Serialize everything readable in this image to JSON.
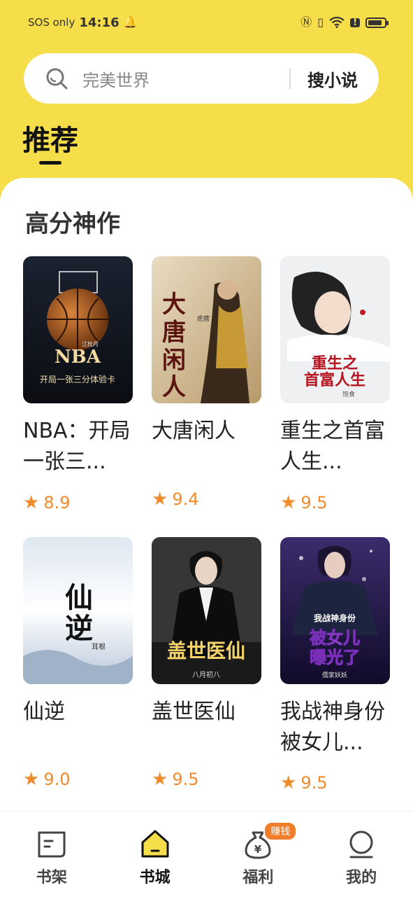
{
  "status_bar": {
    "carrier": "SOS only",
    "time": "14:16",
    "battery_level": 0.85
  },
  "search": {
    "placeholder": "完美世界",
    "button_label": "搜小说"
  },
  "tabs": [
    {
      "label": "推荐",
      "active": true
    }
  ],
  "section": {
    "title": "高分神作"
  },
  "books": [
    {
      "title": "NBA：开局一张三...",
      "rating": "8.9",
      "cover_text": "NBA",
      "cover_sub": "开局一张三分体验卡",
      "cover_author": "江枕月"
    },
    {
      "title": "大唐闲人",
      "rating": "9.4",
      "cover_text": "大唐闲人",
      "cover_author": "疙瘩"
    },
    {
      "title": "重生之首富人生...",
      "rating": "9.5",
      "cover_text": "重生之首富人生",
      "cover_author": "饱食"
    },
    {
      "title": "仙逆",
      "rating": "9.0",
      "cover_text": "仙逆",
      "cover_author": "耳根"
    },
    {
      "title": "盖世医仙",
      "rating": "9.5",
      "cover_text": "盖世医仙",
      "cover_author": "八月初八"
    },
    {
      "title": "我战神身份被女儿...",
      "rating": "9.5",
      "cover_text": "被女儿曝光了",
      "cover_sub": "我战神身份",
      "cover_author": "儒家妖妖"
    }
  ],
  "bottom_nav": [
    {
      "label": "书架",
      "icon": "bookshelf-icon",
      "active": false
    },
    {
      "label": "书城",
      "icon": "bookstore-home-icon",
      "active": true
    },
    {
      "label": "福利",
      "icon": "money-bag-icon",
      "active": false,
      "badge": "赚钱"
    },
    {
      "label": "我的",
      "icon": "profile-icon",
      "active": false
    }
  ],
  "colors": {
    "header_yellow": "#f6dd4a",
    "rating_orange": "#f08a2b",
    "badge_orange": "#f07d2a"
  }
}
